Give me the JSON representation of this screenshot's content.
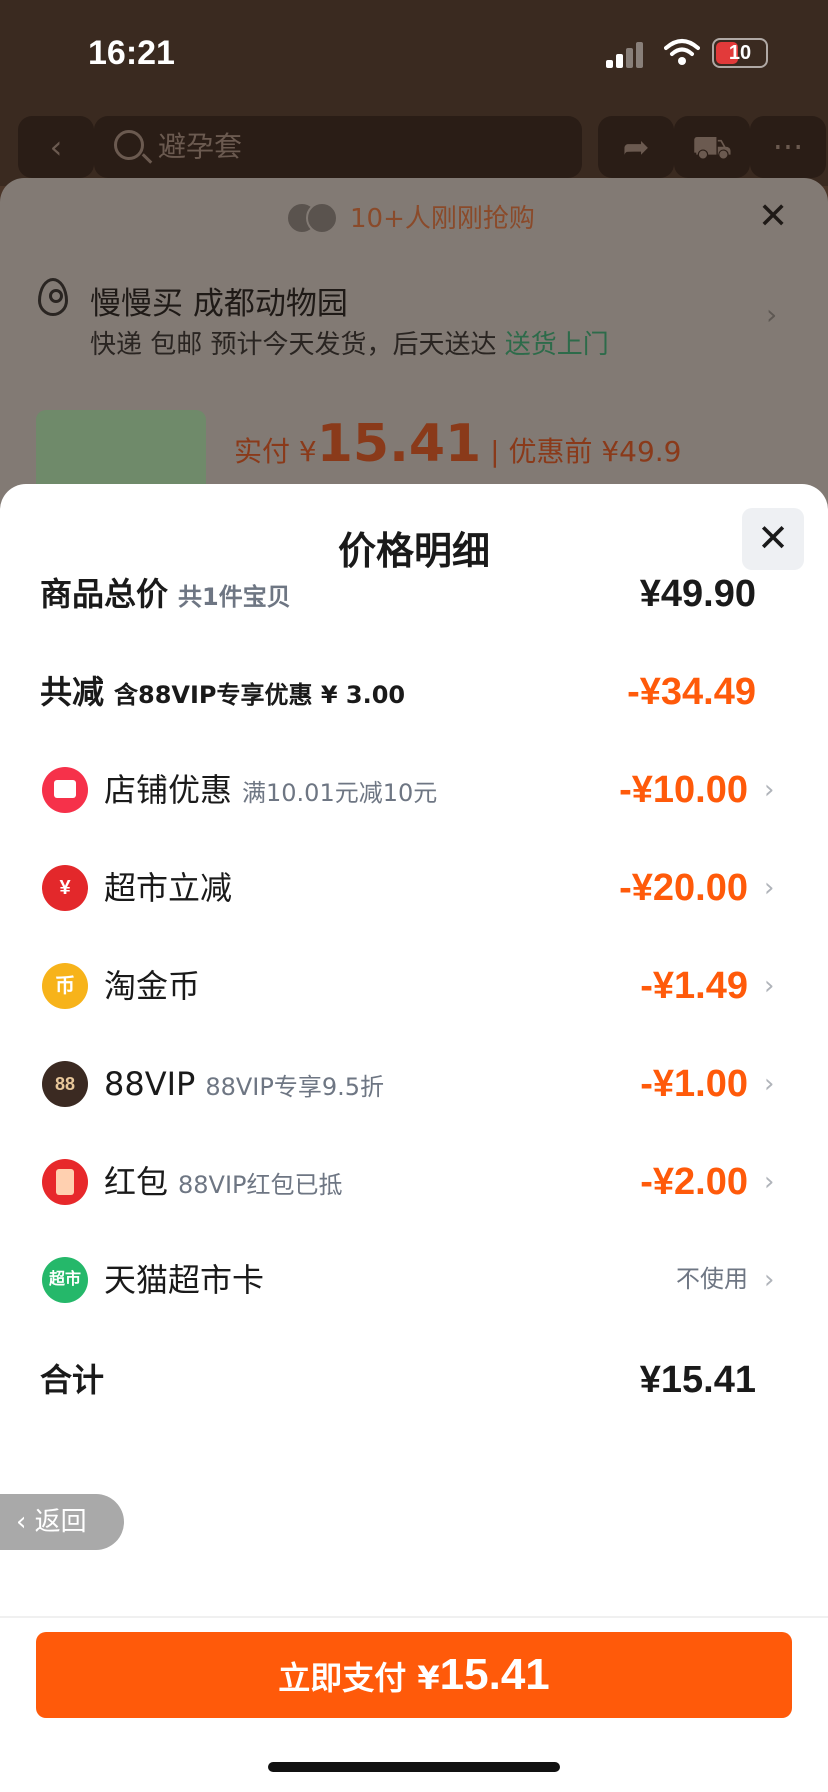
{
  "status": {
    "time": "16:21",
    "battery": "10"
  },
  "topnav": {
    "search_placeholder": "避孕套"
  },
  "under": {
    "grab_text": "10+人刚刚抢购",
    "address_name": "慢慢买 成都动物园",
    "delivery_text": "快递 包邮 预计今天发货，后天送达",
    "delivery_green": "送货上门",
    "price_label": "实付 ¥",
    "price_big": "15.41",
    "price_before": " | 优惠前 ¥49.9"
  },
  "sheet": {
    "title": "价格明细",
    "rows": [
      {
        "label": "商品总价",
        "sub": "共1件宝贝",
        "value": "¥49.90"
      },
      {
        "label": "共减",
        "sub": "含88VIP专享优惠 ¥ 3.00",
        "value": "-¥34.49"
      },
      {
        "label": "店铺优惠",
        "sub": "满10.01元减10元",
        "value": "-¥10.00"
      },
      {
        "label": "超市立减",
        "sub": "",
        "value": "-¥20.00"
      },
      {
        "label": "淘金币",
        "sub": "",
        "value": "-¥1.49"
      },
      {
        "label": "88VIP",
        "sub": "88VIP专享9.5折",
        "value": "-¥1.00"
      },
      {
        "label": "红包",
        "sub": "88VIP红包已抵",
        "value": "-¥2.00"
      },
      {
        "label": "天猫超市卡",
        "sub": "",
        "value": "不使用"
      },
      {
        "label": "合计",
        "sub": "",
        "value": "¥15.41"
      }
    ],
    "icons": {
      "coin": "币",
      "vip": "88",
      "market": "¥",
      "card": "超市"
    },
    "watermark": "",
    "back_label": "返回",
    "pay_label": "立即支付 ¥",
    "pay_amount": "15.41"
  }
}
